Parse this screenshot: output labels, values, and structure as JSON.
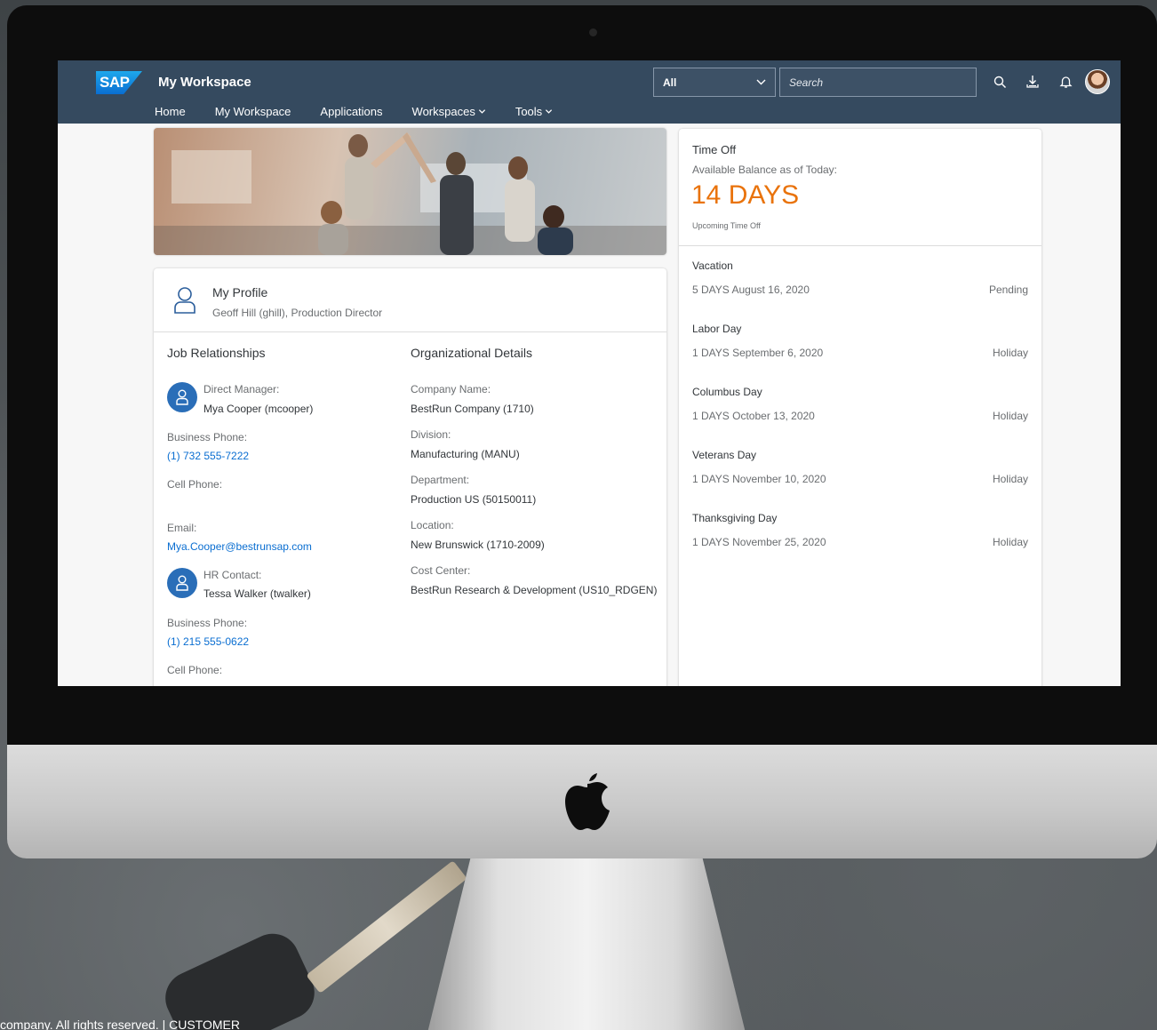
{
  "footer": {
    "text": "company. All rights reserved.  |  CUSTOMER"
  },
  "shell": {
    "logo_text": "SAP",
    "title": "My Workspace",
    "scope_value": "All",
    "search_placeholder": "Search",
    "nav": [
      {
        "label": "Home",
        "has_menu": false
      },
      {
        "label": "My Workspace",
        "has_menu": false
      },
      {
        "label": "Applications",
        "has_menu": false
      },
      {
        "label": "Workspaces",
        "has_menu": true
      },
      {
        "label": "Tools",
        "has_menu": true
      }
    ]
  },
  "profile": {
    "title": "My Profile",
    "subtitle": "Geoff Hill (ghill), Production Director",
    "job_relationships": {
      "title": "Job Relationships",
      "manager_label": "Direct Manager:",
      "manager_name": "Mya Cooper (mcooper)",
      "manager_business_phone_label": "Business Phone:",
      "manager_business_phone": "(1) 732 555-7222",
      "manager_cell_label": "Cell Phone:",
      "manager_email_label": "Email:",
      "manager_email": "Mya.Cooper@bestrunsap.com",
      "hr_label": "HR Contact:",
      "hr_name": "Tessa Walker (twalker)",
      "hr_business_phone_label": "Business Phone:",
      "hr_business_phone": "(1) 215 555-0622",
      "hr_cell_label": "Cell Phone:"
    },
    "org_details": {
      "title": "Organizational Details",
      "fields": [
        {
          "label": "Company Name:",
          "value": "BestRun Company (1710)"
        },
        {
          "label": "Division:",
          "value": "Manufacturing (MANU)"
        },
        {
          "label": "Department:",
          "value": "Production US (50150011)"
        },
        {
          "label": "Location:",
          "value": "New Brunswick (1710-2009)"
        },
        {
          "label": "Cost Center:",
          "value": "BestRun Research & Development (US10_RDGEN)"
        }
      ]
    }
  },
  "time_off": {
    "title": "Time Off",
    "balance_label": "Available Balance as of Today:",
    "balance_value": "14 DAYS",
    "upcoming_label": "Upcoming Time Off",
    "items": [
      {
        "name": "Vacation",
        "date": "5 DAYS August 16, 2020",
        "status": "Pending"
      },
      {
        "name": "Labor Day",
        "date": "1 DAYS September 6, 2020",
        "status": "Holiday"
      },
      {
        "name": "Columbus Day",
        "date": "1 DAYS October 13, 2020",
        "status": "Holiday"
      },
      {
        "name": "Veterans Day",
        "date": "1 DAYS November 10, 2020",
        "status": "Holiday"
      },
      {
        "name": "Thanksgiving Day",
        "date": "1 DAYS November 25, 2020",
        "status": "Holiday"
      }
    ]
  },
  "icons": {
    "search": "search-icon",
    "download": "download-icon",
    "bell": "bell-icon",
    "person": "person-icon",
    "chevron": "chevron-down-icon",
    "apple": "apple-logo"
  },
  "colors": {
    "shellbar": "#354a5f",
    "accent_orange": "#e9730c",
    "link_blue": "#0a6ed1",
    "avatar_blue": "#2a6eb8"
  }
}
